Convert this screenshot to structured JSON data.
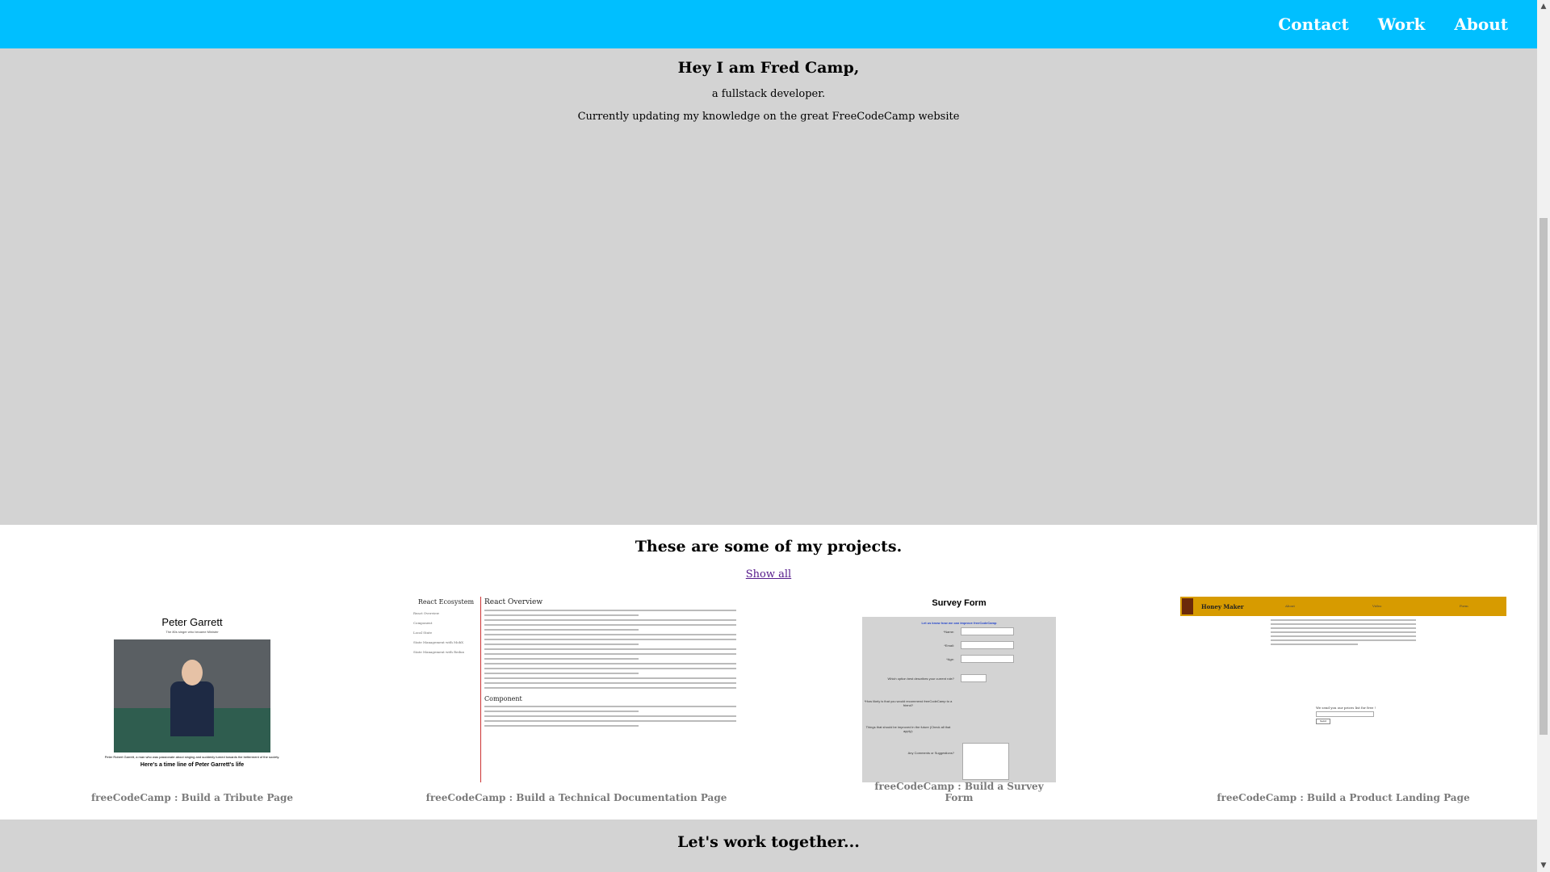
{
  "nav": {
    "links": [
      "Contact",
      "Work",
      "About"
    ]
  },
  "welcome": {
    "heading": "Hey I am Fred Camp,",
    "subtitle": "a fullstack developer.",
    "tagline": "Currently updating my knowledge on the great FreeCodeCamp website"
  },
  "projects": {
    "heading": "These are some of my projects.",
    "show_all": "Show all",
    "items": [
      {
        "caption": "freeCodeCamp : Build a Tribute Page",
        "thumb": {
          "title": "Peter Garrett",
          "subtitle": "The 80s singer who became Minister",
          "photo_caption": "Peter Robert Garrett, a man who was passionate about singing and suddenly turned towards the betterment of the society.",
          "timeline_heading": "Here's a time line of Peter Garrett's life"
        }
      },
      {
        "caption": "freeCodeCamp : Build a Technical Documentation Page",
        "thumb": {
          "nav_title": "React Ecosystem",
          "nav_items": [
            "React Overview",
            "Component",
            "Local State",
            "State Management with MobX",
            "State Management with Redux"
          ],
          "main_title": "React Overview",
          "section": "Component"
        }
      },
      {
        "caption": "freeCodeCamp : Build a Survey Form",
        "thumb": {
          "title": "Survey Form",
          "intro": "Let us know how we can improve freeCodeCamp",
          "fields": [
            "*Name:",
            "*Email:",
            "*Age:",
            "Which option best describes your current role?",
            "*How likely is that you would recommend freeCodeCamp to a friend?",
            "Things that should be improved in the future (Check all that apply):",
            "Any Comments or Suggestions?"
          ]
        }
      },
      {
        "caption": "freeCodeCamp : Build a Product Landing Page",
        "thumb": {
          "brand": "Honey Maker",
          "links": [
            "About",
            "Video",
            "Form"
          ],
          "form_prompt": "We send you our prices list for free !",
          "button": "Send"
        }
      }
    ]
  },
  "contact": {
    "heading": "Let's work together..."
  },
  "colors": {
    "nav_bg": "#00bfff",
    "section_gray": "#d3d3d3",
    "caption_gray": "#7a7a7a"
  }
}
